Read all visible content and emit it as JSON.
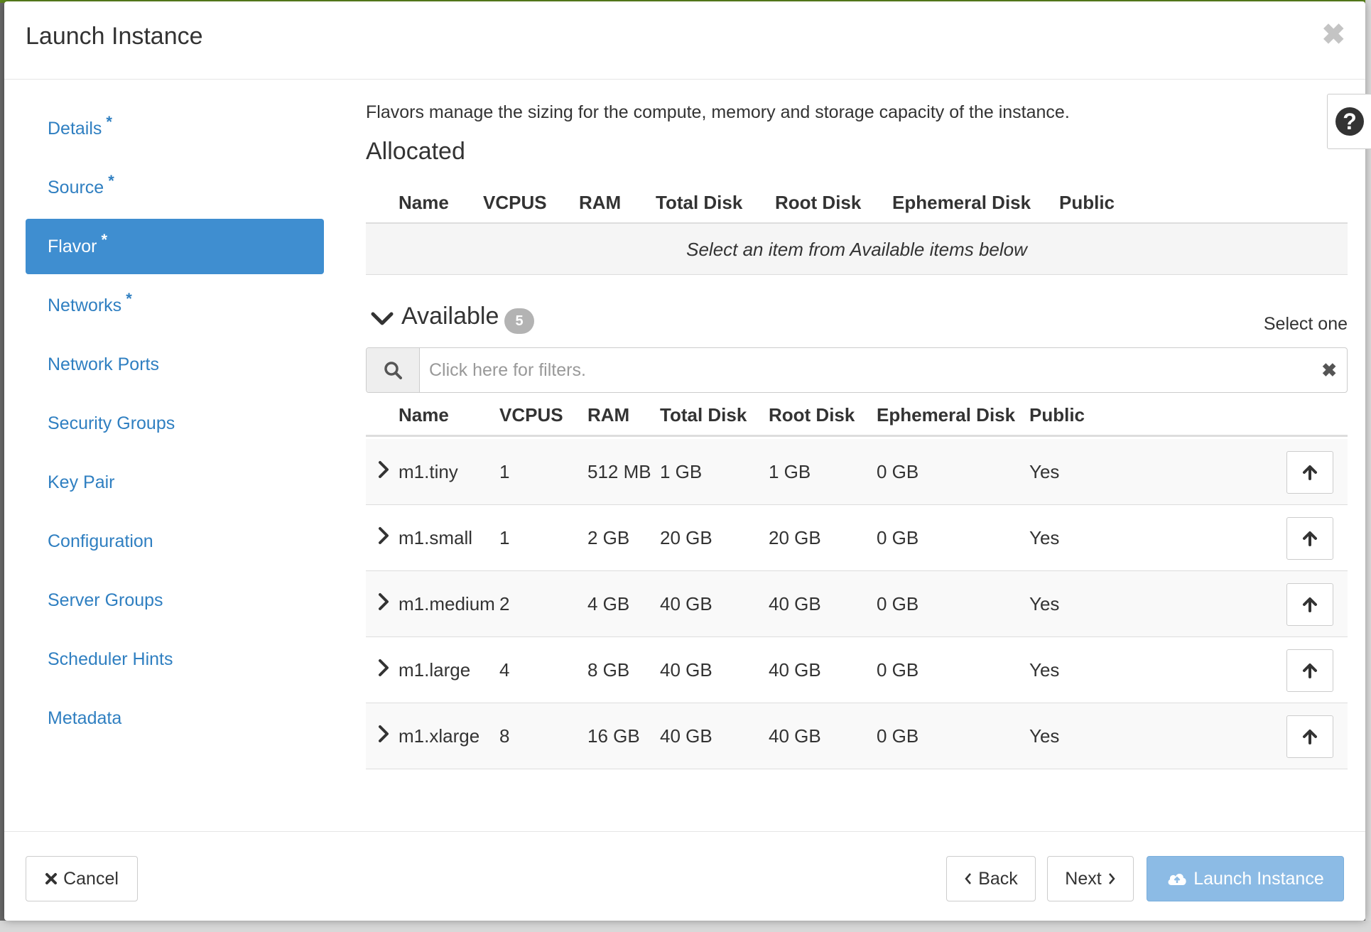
{
  "modal": {
    "title": "Launch Instance",
    "close_symbol": "✖"
  },
  "sidebar": {
    "items": [
      {
        "label": "Details",
        "required": "*"
      },
      {
        "label": "Source",
        "required": "*"
      },
      {
        "label": "Flavor",
        "required": "*",
        "active": true
      },
      {
        "label": "Networks",
        "required": "*"
      },
      {
        "label": "Network Ports"
      },
      {
        "label": "Security Groups"
      },
      {
        "label": "Key Pair"
      },
      {
        "label": "Configuration"
      },
      {
        "label": "Server Groups"
      },
      {
        "label": "Scheduler Hints"
      },
      {
        "label": "Metadata"
      }
    ]
  },
  "content": {
    "intro": "Flavors manage the sizing for the compute, memory and storage capacity of the instance.",
    "help_symbol": "?",
    "allocated": {
      "title": "Allocated",
      "columns": [
        "Name",
        "VCPUS",
        "RAM",
        "Total Disk",
        "Root Disk",
        "Ephemeral Disk",
        "Public"
      ],
      "empty_message": "Select an item from Available items below"
    },
    "available": {
      "title": "Available",
      "count": "5",
      "select_hint": "Select one",
      "filter_placeholder": "Click here for filters.",
      "columns": [
        "Name",
        "VCPUS",
        "RAM",
        "Total Disk",
        "Root Disk",
        "Ephemeral Disk",
        "Public"
      ],
      "rows": [
        {
          "name": "m1.tiny",
          "vcpus": "1",
          "ram": "512 MB",
          "total_disk": "1 GB",
          "root_disk": "1 GB",
          "ephemeral_disk": "0 GB",
          "public": "Yes"
        },
        {
          "name": "m1.small",
          "vcpus": "1",
          "ram": "2 GB",
          "total_disk": "20 GB",
          "root_disk": "20 GB",
          "ephemeral_disk": "0 GB",
          "public": "Yes"
        },
        {
          "name": "m1.medium",
          "vcpus": "2",
          "ram": "4 GB",
          "total_disk": "40 GB",
          "root_disk": "40 GB",
          "ephemeral_disk": "0 GB",
          "public": "Yes"
        },
        {
          "name": "m1.large",
          "vcpus": "4",
          "ram": "8 GB",
          "total_disk": "40 GB",
          "root_disk": "40 GB",
          "ephemeral_disk": "0 GB",
          "public": "Yes"
        },
        {
          "name": "m1.xlarge",
          "vcpus": "8",
          "ram": "16 GB",
          "total_disk": "40 GB",
          "root_disk": "40 GB",
          "ephemeral_disk": "0 GB",
          "public": "Yes"
        }
      ]
    }
  },
  "footer": {
    "cancel_label": "Cancel",
    "back_label": "Back",
    "next_label": "Next",
    "launch_label": "Launch Instance"
  },
  "colors": {
    "link": "#2f7fc1",
    "active_nav": "#3f8ed0",
    "primary_disabled": "#8cbbe5",
    "top_bar": "#5f8a1e"
  },
  "icons": {
    "close": "close-icon",
    "help": "question-circle-icon",
    "collapse": "chevron-down-icon",
    "search": "search-icon",
    "clear": "clear-filter-icon",
    "expand_row": "chevron-right-icon",
    "allocate": "arrow-up-icon",
    "cancel": "times-icon",
    "back": "chevron-left-icon",
    "next": "chevron-right-icon",
    "launch": "cloud-upload-icon"
  }
}
